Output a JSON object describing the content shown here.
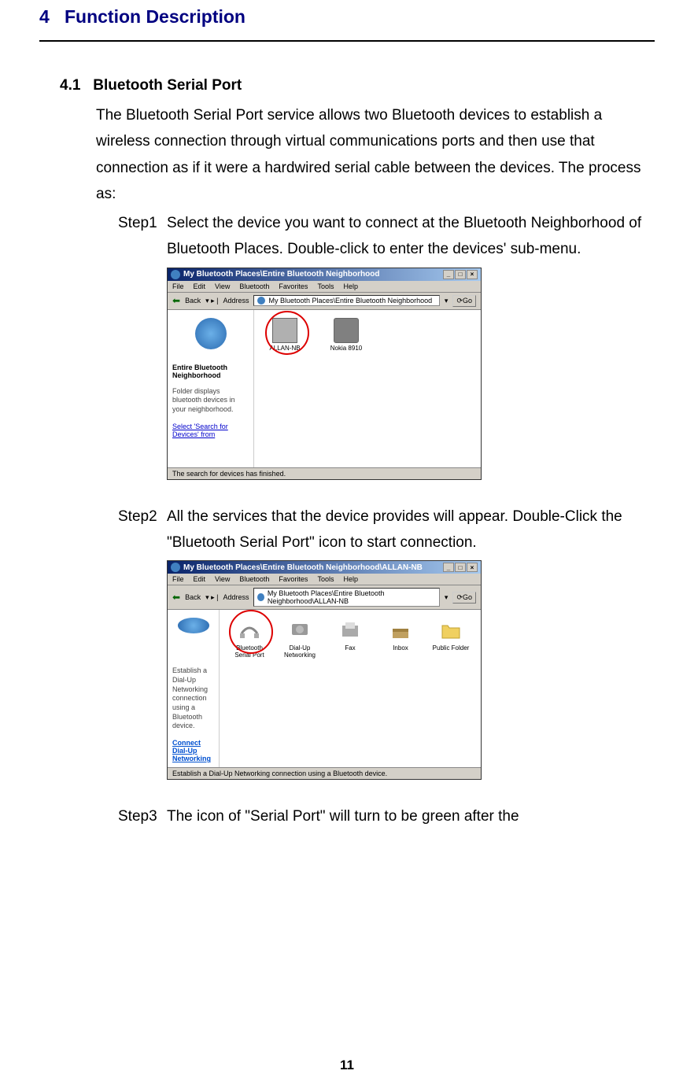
{
  "chapter": {
    "number": "4",
    "title": "Function Description"
  },
  "section": {
    "number": "4.1",
    "title": "Bluetooth Serial Port"
  },
  "intro": "The Bluetooth Serial Port service allows two Bluetooth devices to establish a wireless connection through virtual communications ports and then use that connection as if it were a hardwired serial cable between the devices. The process as:",
  "steps": {
    "step1": {
      "label": "Step1",
      "text": "Select the device you want to connect at the Bluetooth Neighborhood of Bluetooth Places. Double-click to enter the devices' sub-menu."
    },
    "step2": {
      "label": "Step2",
      "text": "All the services that the device provides will appear. Double-Click the \"Bluetooth Serial Port\" icon to start connection."
    },
    "step3": {
      "label": "Step3",
      "text": "The icon of \"Serial Port\" will turn to be green after the"
    }
  },
  "window1": {
    "title": "My Bluetooth Places\\Entire Bluetooth Neighborhood",
    "menu": [
      "File",
      "Edit",
      "View",
      "Bluetooth",
      "Favorites",
      "Tools",
      "Help"
    ],
    "back": "Back",
    "address_label": "Address",
    "address_value": "My Bluetooth Places\\Entire Bluetooth Neighborhood",
    "go": "Go",
    "sidebar": {
      "title": "Entire Bluetooth Neighborhood",
      "desc": "Folder displays bluetooth devices in your neighborhood.",
      "link": "Select 'Search for Devices' from"
    },
    "devices": {
      "d1": "ALLAN-NB",
      "d2": "Nokia 8910"
    },
    "status": "The search for devices has finished."
  },
  "window2": {
    "title": "My Bluetooth Places\\Entire Bluetooth Neighborhood\\ALLAN-NB",
    "menu": [
      "File",
      "Edit",
      "View",
      "Bluetooth",
      "Favorites",
      "Tools",
      "Help"
    ],
    "back": "Back",
    "address_label": "Address",
    "address_value": "My Bluetooth Places\\Entire Bluetooth Neighborhood\\ALLAN-NB",
    "go": "Go",
    "sidebar": {
      "desc": "Establish a Dial-Up Networking connection using a Bluetooth device.",
      "link": "Connect Dial-Up Networking"
    },
    "services": {
      "s1": "Bluetooth Serial Port",
      "s2": "Dial-Up Networking",
      "s3": "Fax",
      "s4": "Inbox",
      "s5": "Public Folder"
    },
    "status": "Establish a Dial-Up Networking connection using a Bluetooth device."
  },
  "page_number": "11"
}
